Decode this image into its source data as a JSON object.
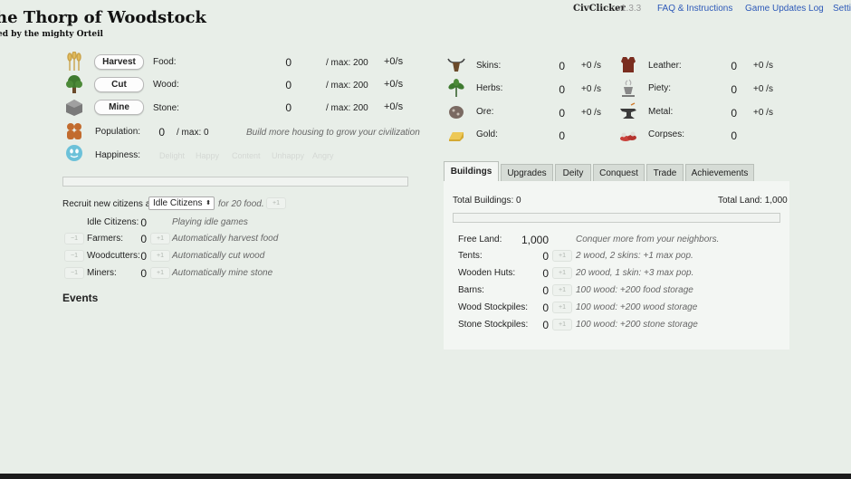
{
  "header": {
    "title": "he Thorp of Woodstock",
    "subtitle": "ed by the mighty Orteil",
    "brand": "CivClicker",
    "version": "v1.3.3",
    "nav": [
      "FAQ & Instructions",
      "Game Updates Log",
      "Setti"
    ]
  },
  "basic_resources": [
    {
      "button": "Harvest",
      "name": "Food:",
      "value": "0",
      "max": "/ max: 200",
      "rate": "+0/s",
      "icon": "wheat-icon"
    },
    {
      "button": "Cut",
      "name": "Wood:",
      "value": "0",
      "max": "/ max: 200",
      "rate": "+0/s",
      "icon": "tree-icon"
    },
    {
      "button": "Mine",
      "name": "Stone:",
      "value": "0",
      "max": "/ max: 200",
      "rate": "+0/s",
      "icon": "stone-icon"
    }
  ],
  "population": {
    "label": "Population:",
    "value": "0",
    "max": "/ max: 0",
    "hint": "Build more housing to grow your civilization"
  },
  "happiness": {
    "label": "Happiness:",
    "disabled_buttons": [
      "Delight",
      "Happy",
      "Content",
      "Unhappy",
      "Angry"
    ]
  },
  "recruit": {
    "prefix": "Recruit new citizens as",
    "selected": "Idle Citizens",
    "suffix": "for 20 food.",
    "plus": "+1"
  },
  "jobs": [
    {
      "name": "Idle Citizens:",
      "value": "0",
      "desc": "Playing idle games"
    },
    {
      "name": "Farmers:",
      "value": "0",
      "desc": "Automatically harvest food"
    },
    {
      "name": "Woodcutters:",
      "value": "0",
      "desc": "Automatically cut wood"
    },
    {
      "name": "Miners:",
      "value": "0",
      "desc": "Automatically mine stone"
    }
  ],
  "job_buttons": {
    "minus": "−1",
    "plus": "+1"
  },
  "events_label": "Events",
  "special_resources_left": [
    {
      "name": "Skins:",
      "value": "0",
      "rate": "+0 /s",
      "icon": "ox-skull-icon"
    },
    {
      "name": "Herbs:",
      "value": "0",
      "rate": "+0 /s",
      "icon": "herb-leaf-icon"
    },
    {
      "name": "Ore:",
      "value": "0",
      "rate": "+0 /s",
      "icon": "ore-rock-icon"
    },
    {
      "name": "Gold:",
      "value": "0",
      "rate": "",
      "icon": "gold-bar-icon"
    }
  ],
  "special_resources_right": [
    {
      "name": "Leather:",
      "value": "0",
      "rate": "+0 /s",
      "icon": "leather-armor-icon"
    },
    {
      "name": "Piety:",
      "value": "0",
      "rate": "+0 /s",
      "icon": "incense-icon"
    },
    {
      "name": "Metal:",
      "value": "0",
      "rate": "+0 /s",
      "icon": "anvil-icon"
    },
    {
      "name": "Corpses:",
      "value": "0",
      "rate": "",
      "icon": "corpses-icon"
    }
  ],
  "tabs": [
    "Buildings",
    "Upgrades",
    "Deity",
    "Conquest",
    "Trade",
    "Achievements"
  ],
  "buildings_panel": {
    "total_buildings": "Total Buildings: 0",
    "total_land": "Total Land: 1,000",
    "free_land_label": "Free Land:",
    "free_land_value": "1,000",
    "free_land_hint": "Conquer more from your neighbors.",
    "plus": "+1",
    "items": [
      {
        "name": "Tents:",
        "value": "0",
        "cost": "2 wood, 2 skins: +1 max pop."
      },
      {
        "name": "Wooden Huts:",
        "value": "0",
        "cost": "20 wood, 1 skin: +3 max pop."
      },
      {
        "name": "Barns:",
        "value": "0",
        "cost": "100 wood: +200 food storage"
      },
      {
        "name": "Wood Stockpiles:",
        "value": "0",
        "cost": "100 wood: +200 wood storage"
      },
      {
        "name": "Stone Stockpiles:",
        "value": "0",
        "cost": "100 wood: +200 stone storage"
      }
    ]
  },
  "colors": {
    "background": "#e8eee8",
    "link": "#2d59b8",
    "panel": "#f3f6f3"
  }
}
